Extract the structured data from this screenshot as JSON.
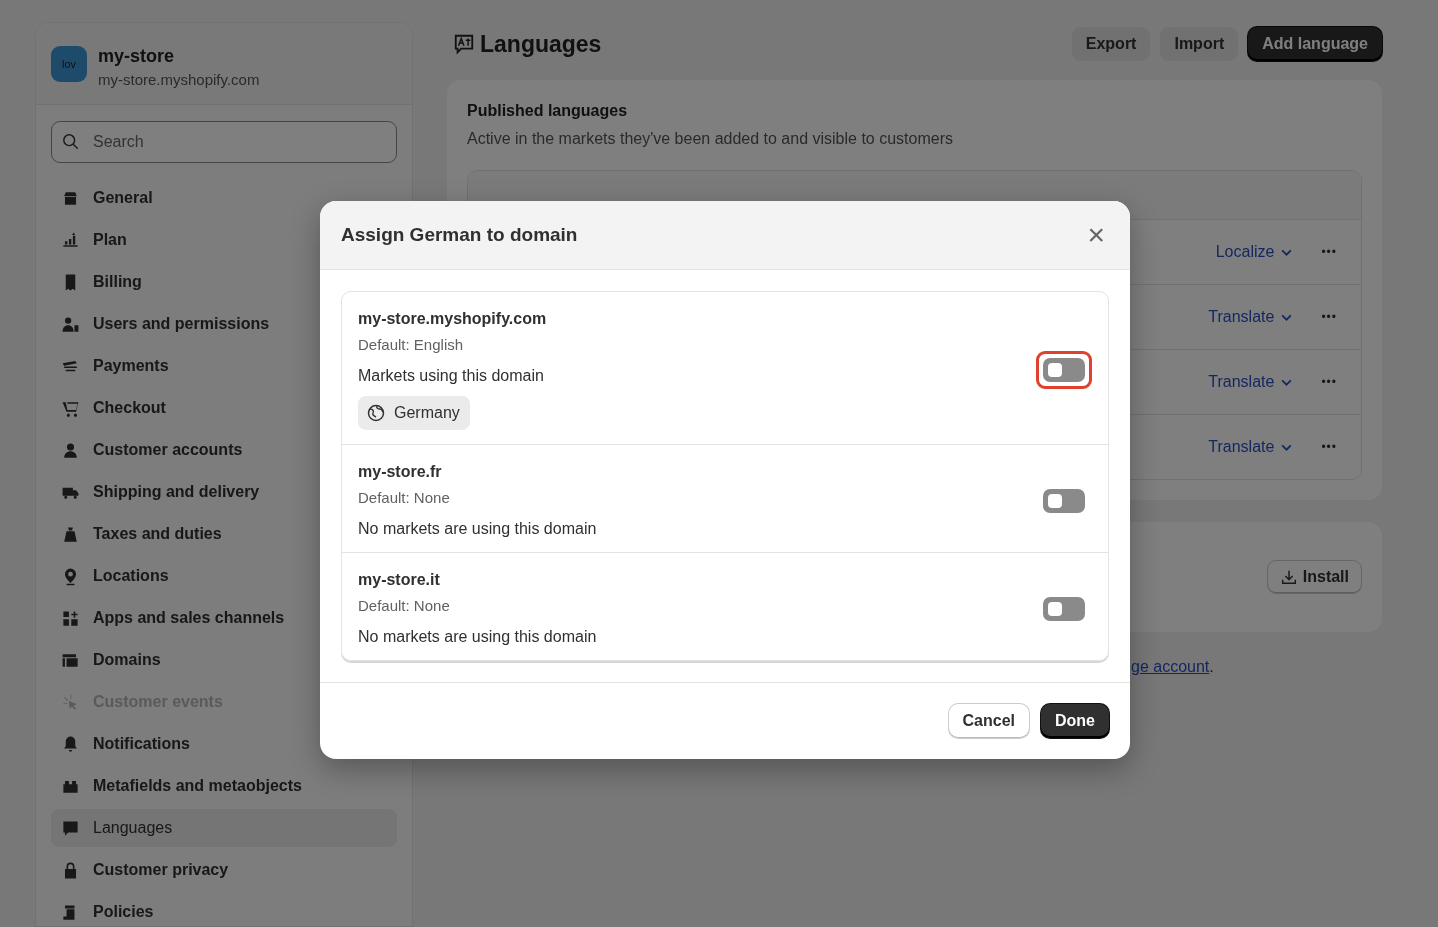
{
  "store": {
    "avatar": "lov",
    "name": "my-store",
    "domain": "my-store.myshopify.com"
  },
  "search": {
    "placeholder": "Search"
  },
  "sidebar": {
    "items": [
      {
        "label": "General",
        "selected": false,
        "disabled": false
      },
      {
        "label": "Plan",
        "selected": false,
        "disabled": false
      },
      {
        "label": "Billing",
        "selected": false,
        "disabled": false
      },
      {
        "label": "Users and permissions",
        "selected": false,
        "disabled": false
      },
      {
        "label": "Payments",
        "selected": false,
        "disabled": false
      },
      {
        "label": "Checkout",
        "selected": false,
        "disabled": false
      },
      {
        "label": "Customer accounts",
        "selected": false,
        "disabled": false
      },
      {
        "label": "Shipping and delivery",
        "selected": false,
        "disabled": false
      },
      {
        "label": "Taxes and duties",
        "selected": false,
        "disabled": false
      },
      {
        "label": "Locations",
        "selected": false,
        "disabled": false
      },
      {
        "label": "Apps and sales channels",
        "selected": false,
        "disabled": false
      },
      {
        "label": "Domains",
        "selected": false,
        "disabled": false
      },
      {
        "label": "Customer events",
        "selected": false,
        "disabled": true
      },
      {
        "label": "Notifications",
        "selected": false,
        "disabled": false
      },
      {
        "label": "Metafields and metaobjects",
        "selected": false,
        "disabled": false
      },
      {
        "label": "Languages",
        "selected": true,
        "disabled": false
      },
      {
        "label": "Customer privacy",
        "selected": false,
        "disabled": false
      },
      {
        "label": "Policies",
        "selected": false,
        "disabled": false
      }
    ]
  },
  "page": {
    "title": "Languages",
    "buttons": [
      {
        "label": "Export",
        "primary": false
      },
      {
        "label": "Import",
        "primary": false
      },
      {
        "label": "Add language",
        "primary": true
      }
    ]
  },
  "published": {
    "title": "Published languages",
    "subtitle": "Active in the markets they've been added to and visible to customers",
    "rows": [
      {
        "action": "Localize",
        "more": "•••"
      },
      {
        "action": "Translate",
        "more": "•••"
      },
      {
        "action": "Translate",
        "more": "•••"
      },
      {
        "action": "Translate",
        "more": "•••"
      }
    ]
  },
  "install_button": "Install",
  "footer_note": {
    "link": "ge account",
    "after": "."
  },
  "modal": {
    "title": "Assign German to domain",
    "close": "×",
    "domains": [
      {
        "name": "my-store.myshopify.com",
        "default": "Default: English",
        "markets_text": "Markets using this domain",
        "markets": [
          "Germany"
        ],
        "on": false,
        "highlighted": true
      },
      {
        "name": "my-store.fr",
        "default": "Default: None",
        "markets_text": "No markets are using this domain",
        "on": false,
        "highlighted": false
      },
      {
        "name": "my-store.it",
        "default": "Default: None",
        "markets_text": "No markets are using this domain",
        "on": false,
        "highlighted": false
      }
    ],
    "buttons": [
      {
        "label": "Cancel",
        "primary": false
      },
      {
        "label": "Done",
        "primary": true
      }
    ]
  }
}
